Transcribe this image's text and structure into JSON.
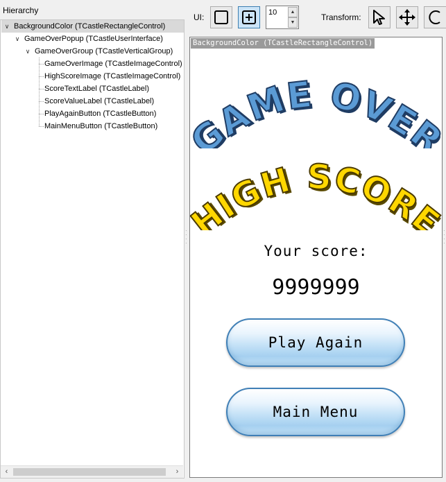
{
  "hierarchy": {
    "title": "Hierarchy",
    "nodes": [
      {
        "label": "BackgroundColor (TCastleRectangleControl)"
      },
      {
        "label": "GameOverPopup (TCastleUserInterface)"
      },
      {
        "label": "GameOverGroup (TCastleVerticalGroup)"
      },
      {
        "label": "GameOverImage (TCastleImageControl)"
      },
      {
        "label": "HighScoreImage (TCastleImageControl)"
      },
      {
        "label": "ScoreTextLabel (TCastleLabel)"
      },
      {
        "label": "ScoreValueLabel (TCastleLabel)"
      },
      {
        "label": "PlayAgainButton (TCastleButton)"
      },
      {
        "label": "MainMenuButton (TCastleButton)"
      }
    ]
  },
  "toolbar": {
    "ui_label": "UI:",
    "spin_value": "10",
    "transform_label": "Transform:"
  },
  "viewport": {
    "selected_tag": "BackgroundColor (TCastleRectangleControl)",
    "game_over_image_text": "GAME OVER",
    "high_score_image_text": "HIGH SCORE",
    "score_label": "Your score:",
    "score_value": "9999999",
    "play_again_label": "Play Again",
    "main_menu_label": "Main Menu"
  },
  "colors": {
    "game_over_fill": "#5b9bd5",
    "high_score_fill": "#ffd700",
    "button_border": "#3f7fb6",
    "selection": "#d9d9d9"
  },
  "icons": [
    "chevron-down-icon",
    "scroll-left-icon",
    "scroll-right-icon",
    "rectangle-ui-icon",
    "add-ui-icon",
    "spin-up-icon",
    "spin-down-icon",
    "select-arrow-icon",
    "move-icon",
    "rotate-icon"
  ]
}
